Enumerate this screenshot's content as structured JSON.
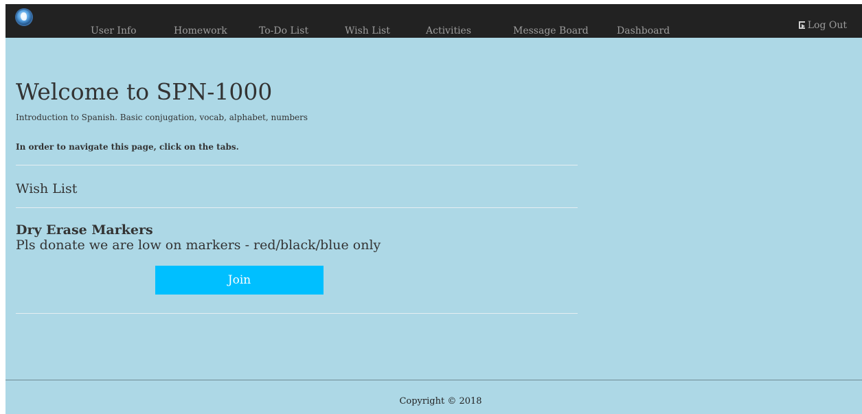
{
  "nav": {
    "items": [
      {
        "label": "User Info"
      },
      {
        "label": "Homework"
      },
      {
        "label": "To-Do List"
      },
      {
        "label": "Wish List"
      },
      {
        "label": "Activities"
      },
      {
        "label": "Message Board"
      },
      {
        "label": "Dashboard"
      }
    ],
    "logout_label": "Log Out",
    "logo_icon": "dragon-logo-icon",
    "logout_icon": "log-out-icon"
  },
  "main": {
    "title": "Welcome to SPN-1000",
    "intro": "Introduction to Spanish. Basic conjugation, vocab, alphabet, numbers",
    "hint": "In order to navigate this page, click on the tabs.",
    "section_title": "Wish List",
    "item": {
      "name": "Dry Erase Markers",
      "description": "Pls donate we are low on markers - red/black/blue only",
      "button_label": "Join"
    }
  },
  "footer": {
    "copyright": "Copyright © 2018"
  },
  "colors": {
    "page_background": "#add8e6",
    "navbar_background": "#222222",
    "nav_text": "#9d9d9d",
    "button_background": "#00bfff",
    "button_text": "#ffffff"
  }
}
